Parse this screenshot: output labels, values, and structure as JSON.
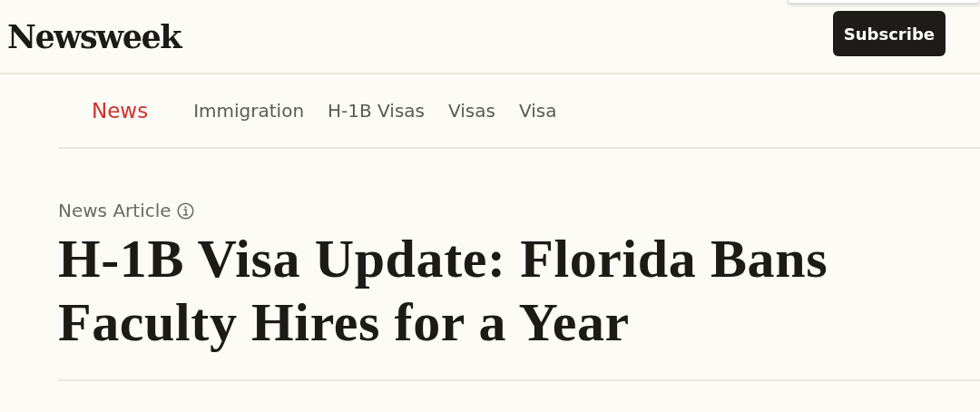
{
  "header": {
    "logo": "Newsweek",
    "subscribe_button": "Subscribe"
  },
  "topics": [
    {
      "label": "News",
      "kind": "section"
    },
    {
      "label": "Immigration",
      "kind": "tag"
    },
    {
      "label": "H-1B Visas",
      "kind": "tag"
    },
    {
      "label": "Visas",
      "kind": "tag"
    },
    {
      "label": "Visa",
      "kind": "tag"
    }
  ],
  "article": {
    "type": "News Article",
    "headline": "H-1B Visa Update: Florida Bans Faculty Hires for a Year"
  }
}
